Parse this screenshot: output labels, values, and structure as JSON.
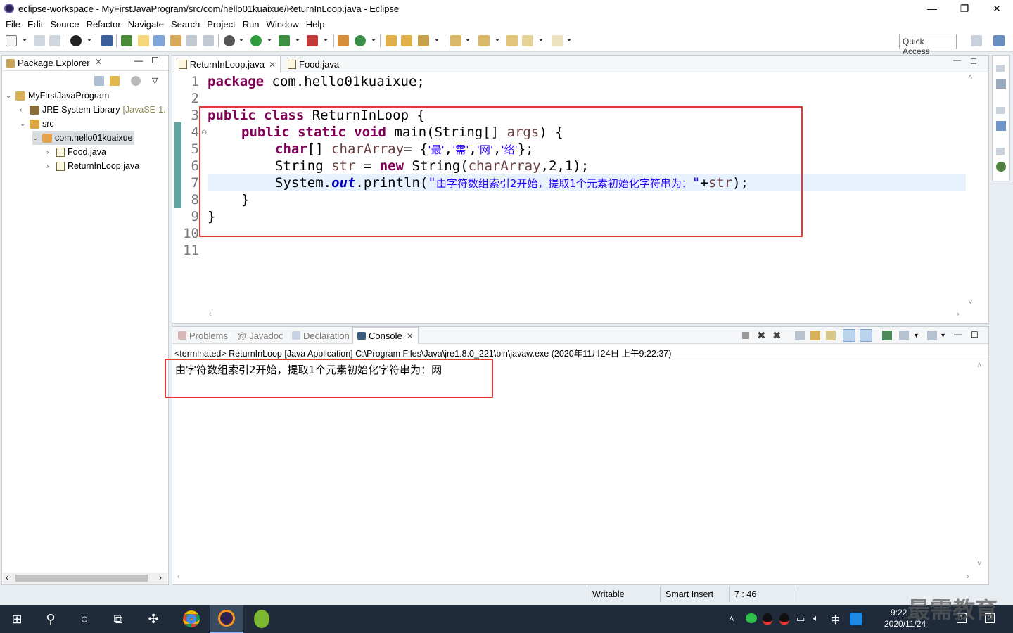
{
  "window": {
    "title": "eclipse-workspace - MyFirstJavaProgram/src/com/hello01kuaixue/ReturnInLoop.java - Eclipse",
    "minimize": "—",
    "maximize": "❐",
    "close": "✕"
  },
  "menu": [
    "File",
    "Edit",
    "Source",
    "Refactor",
    "Navigate",
    "Search",
    "Project",
    "Run",
    "Window",
    "Help"
  ],
  "quick_access": "Quick Access",
  "package_explorer": {
    "title": "Package Explorer",
    "tree": [
      {
        "label": "MyFirstJavaProgram",
        "twisty": "⌄"
      },
      {
        "label": "JRE System Library",
        "suffix": "[JavaSE-1.",
        "twisty": "›"
      },
      {
        "label": "src",
        "twisty": "⌄"
      },
      {
        "label": "com.hello01kuaixue",
        "twisty": "⌄"
      },
      {
        "label": "Food.java",
        "twisty": "›"
      },
      {
        "label": "ReturnInLoop.java",
        "twisty": "›"
      }
    ]
  },
  "editor": {
    "tabs": [
      {
        "label": "ReturnInLoop.java",
        "active": true
      },
      {
        "label": "Food.java",
        "active": false
      }
    ],
    "line_numbers": [
      "1",
      "2",
      "3",
      "4",
      "5",
      "6",
      "7",
      "8",
      "9",
      "10",
      "11"
    ],
    "code": {
      "l1_kw": "package",
      "l1_rest": " com.hello01kuaixue;",
      "l3_kw1": "public",
      "l3_kw2": "class",
      "l3_rest": " ReturnInLoop {",
      "l4_kw1": "public",
      "l4_kw2": "static",
      "l4_kw3": "void",
      "l4_a": " main(String[] ",
      "l4_var": "args",
      "l4_b": ") {",
      "l5_kw": "char",
      "l5_a": "[] ",
      "l5_var": "charArray",
      "l5_b": "= {",
      "l5_c1": "'最'",
      "l5_c2": "'需'",
      "l5_c3": "'网'",
      "l5_c4": "'络'",
      "l5_end": "};",
      "l6_a": "String ",
      "l6_var1": "str",
      "l6_b": " = ",
      "l6_kw": "new",
      "l6_c": " String(",
      "l6_var2": "charArray",
      "l6_d": ",2,1);",
      "l7_a": "System.",
      "l7_fld": "out",
      "l7_b": ".println(",
      "l7_q1": "\"",
      "l7_str": "由字符数组索引2开始，提取1个元素初始化字符串为：",
      "l7_q2": "\"",
      "l7_plus": "+",
      "l7_var": "str",
      "l7_end": ");",
      "l8": "}",
      "l9": "}"
    }
  },
  "bottom": {
    "tabs": [
      "Problems",
      "Javadoc",
      "Declaration",
      "Console"
    ],
    "active_tab": "Console",
    "terminated": "<terminated> ReturnInLoop [Java Application] C:\\Program Files\\Java\\jre1.8.0_221\\bin\\javaw.exe (2020年11月24日 上午9:22:37)",
    "output": "由字符数组索引2开始，提取1个元素初始化字符串为：网"
  },
  "status": {
    "writable": "Writable",
    "insert_mode": "Smart Insert",
    "position": "7 : 46"
  },
  "taskbar": {
    "time": "9:22",
    "date": "2020/11/24",
    "ime": "中",
    "watermark": "最需教育",
    "badge1": "1",
    "badge2": "2"
  }
}
